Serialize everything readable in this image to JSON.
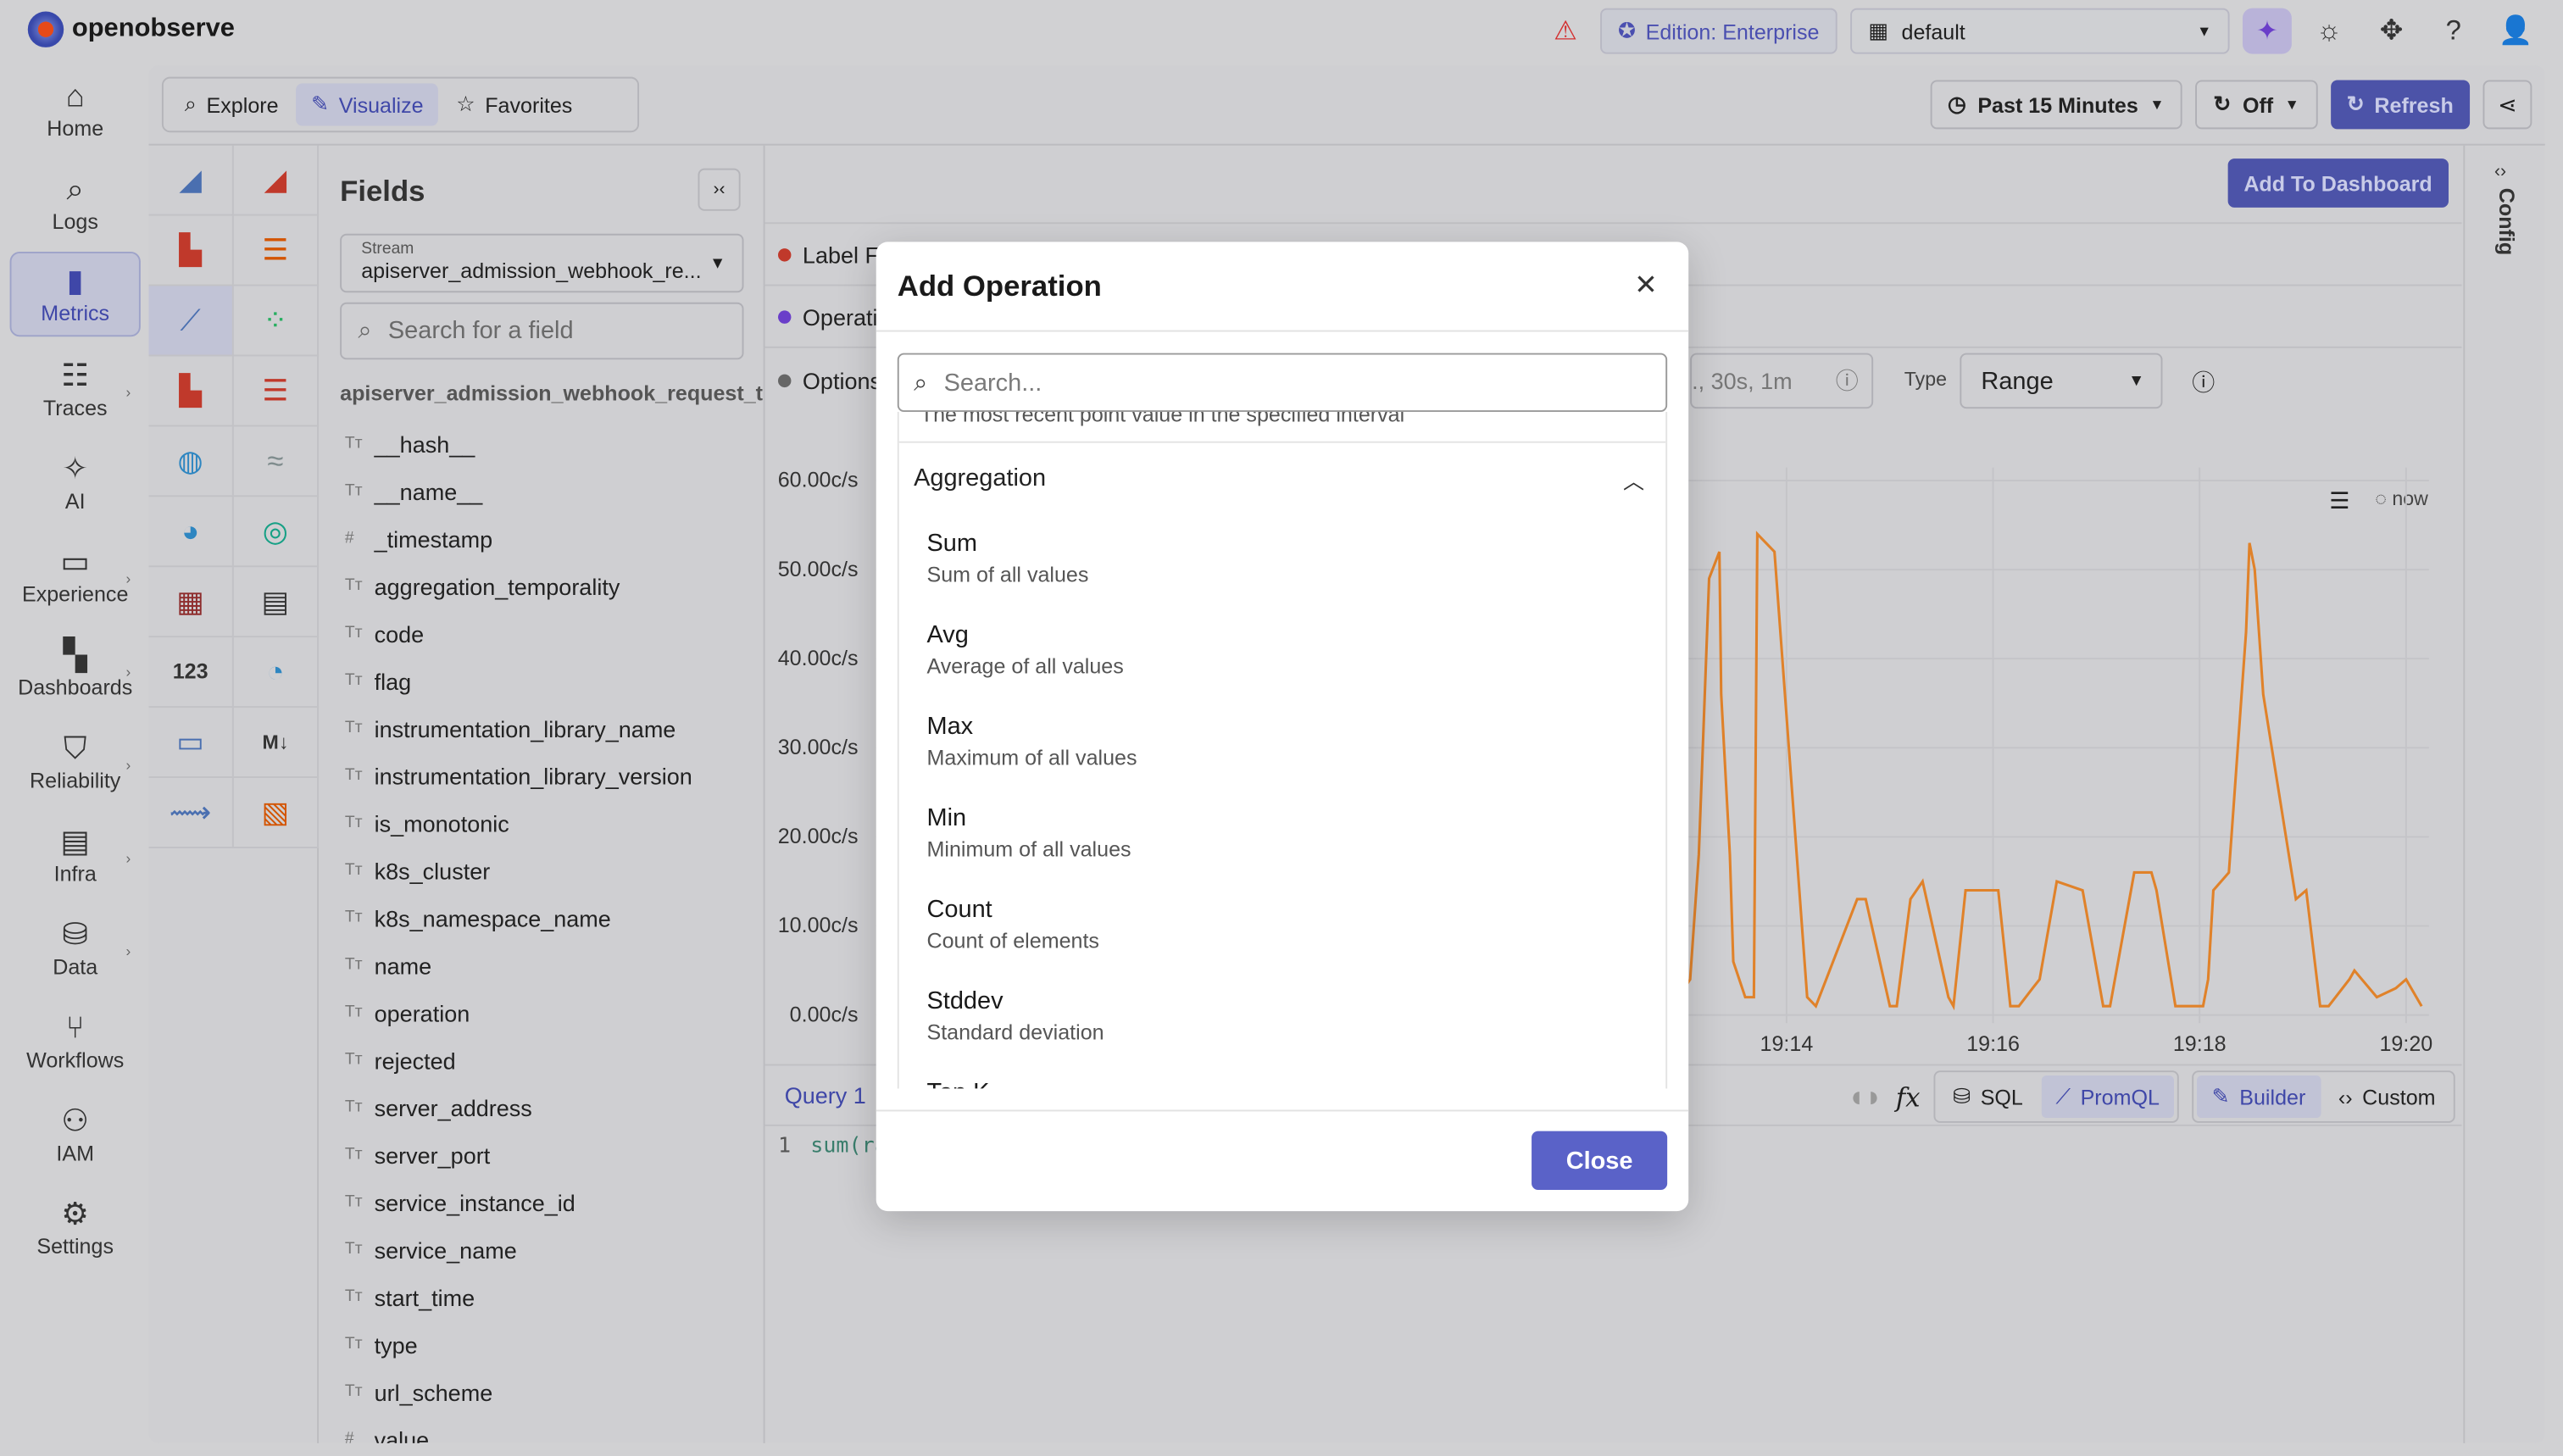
{
  "app": {
    "name": "openobserve"
  },
  "topbar": {
    "edition": "Edition: Enterprise",
    "org": "default"
  },
  "nav": [
    {
      "label": "Home",
      "icon": "home-icon"
    },
    {
      "label": "Logs",
      "icon": "search-icon"
    },
    {
      "label": "Metrics",
      "icon": "bar-chart-icon"
    },
    {
      "label": "Traces",
      "icon": "traces-icon"
    },
    {
      "label": "AI",
      "icon": "sparkles-icon"
    },
    {
      "label": "Experience",
      "icon": "devices-icon"
    },
    {
      "label": "Dashboards",
      "icon": "dashboard-icon"
    },
    {
      "label": "Reliability",
      "icon": "shield-icon"
    },
    {
      "label": "Infra",
      "icon": "server-icon"
    },
    {
      "label": "Data",
      "icon": "database-icon"
    },
    {
      "label": "Workflows",
      "icon": "workflow-icon"
    },
    {
      "label": "IAM",
      "icon": "users-icon"
    },
    {
      "label": "Settings",
      "icon": "gear-icon"
    }
  ],
  "tabs": {
    "explore": "Explore",
    "visualize": "Visualize",
    "favorites": "Favorites"
  },
  "toolbar": {
    "time_range": "Past 15 Minutes",
    "auto_refresh": "Off",
    "refresh": "Refresh",
    "add_to_dashboard": "Add To Dashboard"
  },
  "fields_panel": {
    "title": "Fields",
    "stream_label": "Stream",
    "stream_value": "apiserver_admission_webhook_re...",
    "search_placeholder": "Search for a field",
    "stream_name": "apiserver_admission_webhook_request_to",
    "fields": [
      {
        "type": "Tт",
        "name": "__hash__"
      },
      {
        "type": "Tт",
        "name": "__name__"
      },
      {
        "type": "#",
        "name": "_timestamp"
      },
      {
        "type": "Tт",
        "name": "aggregation_temporality"
      },
      {
        "type": "Tт",
        "name": "code"
      },
      {
        "type": "Tт",
        "name": "flag"
      },
      {
        "type": "Tт",
        "name": "instrumentation_library_name"
      },
      {
        "type": "Tт",
        "name": "instrumentation_library_version"
      },
      {
        "type": "Tт",
        "name": "is_monotonic"
      },
      {
        "type": "Tт",
        "name": "k8s_cluster"
      },
      {
        "type": "Tт",
        "name": "k8s_namespace_name"
      },
      {
        "type": "Tт",
        "name": "name"
      },
      {
        "type": "Tт",
        "name": "operation"
      },
      {
        "type": "Tт",
        "name": "rejected"
      },
      {
        "type": "Tт",
        "name": "server_address"
      },
      {
        "type": "Tт",
        "name": "server_port"
      },
      {
        "type": "Tт",
        "name": "service_instance_id"
      },
      {
        "type": "Tт",
        "name": "service_name"
      },
      {
        "type": "Tт",
        "name": "start_time"
      },
      {
        "type": "Tт",
        "name": "type"
      },
      {
        "type": "Tт",
        "name": "url_scheme"
      },
      {
        "type": "#",
        "name": "value"
      }
    ]
  },
  "builder": {
    "label_filters": "Label F",
    "operations": "Operati",
    "options": "Options",
    "step_placeholder": "., 30s, 1m",
    "type_label": "Type",
    "type_value": "Range",
    "legend_now": "now"
  },
  "query": {
    "tab": "Query 1",
    "line_no": "1",
    "code": "sum(ra",
    "sql": "SQL",
    "promql": "PromQL",
    "builder": "Builder",
    "custom": "Custom"
  },
  "config_label": "Config",
  "chart_data": {
    "type": "line",
    "title": "",
    "xlabel": "",
    "ylabel": "",
    "y_ticks": [
      "60.00c/s",
      "50.00c/s",
      "40.00c/s",
      "30.00c/s",
      "20.00c/s",
      "10.00c/s",
      "0.00c/s"
    ],
    "x_ticks": [
      "19:14",
      "19:16",
      "19:18",
      "19:20"
    ],
    "ylim": [
      0,
      60
    ],
    "line_color": "#e0822a",
    "series": [
      {
        "x": [
          "19:12:51",
          "19:12:57",
          "19:13:04",
          "19:13:09",
          "19:13:15",
          "19:13:21",
          "19:13:22",
          "19:13:27",
          "19:13:29",
          "19:13:36",
          "19:13:41",
          "19:13:43",
          "19:13:53",
          "19:14:12",
          "19:14:17",
          "19:14:41",
          "19:14:46",
          "19:15:00",
          "19:15:04",
          "19:15:12",
          "19:15:19",
          "19:15:34",
          "19:15:37",
          "19:15:44",
          "19:16:03",
          "19:16:10",
          "19:16:15",
          "19:16:23",
          "19:16:27",
          "19:16:37",
          "19:16:52",
          "19:17:04",
          "19:17:08",
          "19:17:22",
          "19:17:32",
          "19:17:35",
          "19:17:46",
          "19:18:02",
          "19:18:05",
          "19:18:08",
          "19:18:17",
          "19:18:27",
          "19:18:29",
          "19:18:32",
          "19:18:37",
          "19:18:56",
          "19:19:02",
          "19:19:10",
          "19:19:15",
          "19:19:27",
          "19:19:30",
          "19:19:43",
          "19:19:54",
          "19:20:00",
          "19:20:09"
        ],
        "y": [
          2,
          2,
          4,
          18,
          49,
          52,
          36,
          18,
          6,
          2,
          2,
          54,
          52,
          2,
          1,
          13,
          13,
          1,
          1,
          13,
          15,
          2,
          1,
          14,
          14,
          1,
          1,
          3,
          4,
          15,
          14,
          1,
          1,
          16,
          16,
          14,
          1,
          1,
          4,
          14,
          16,
          43,
          53,
          50,
          36,
          13,
          14,
          1,
          1,
          4,
          5,
          2,
          3,
          4,
          1
        ]
      }
    ]
  },
  "modal": {
    "title": "Add Operation",
    "search_placeholder": "Search...",
    "cut_desc": "The most recent point value in the specified interval",
    "group": "Aggregation",
    "options": [
      {
        "name": "Sum",
        "desc": "Sum of all values"
      },
      {
        "name": "Avg",
        "desc": "Average of all values"
      },
      {
        "name": "Max",
        "desc": "Maximum of all values"
      },
      {
        "name": "Min",
        "desc": "Minimum of all values"
      },
      {
        "name": "Count",
        "desc": "Count of elements"
      },
      {
        "name": "Stddev",
        "desc": "Standard deviation"
      },
      {
        "name": "Top K",
        "desc": ""
      }
    ],
    "close": "Close"
  }
}
